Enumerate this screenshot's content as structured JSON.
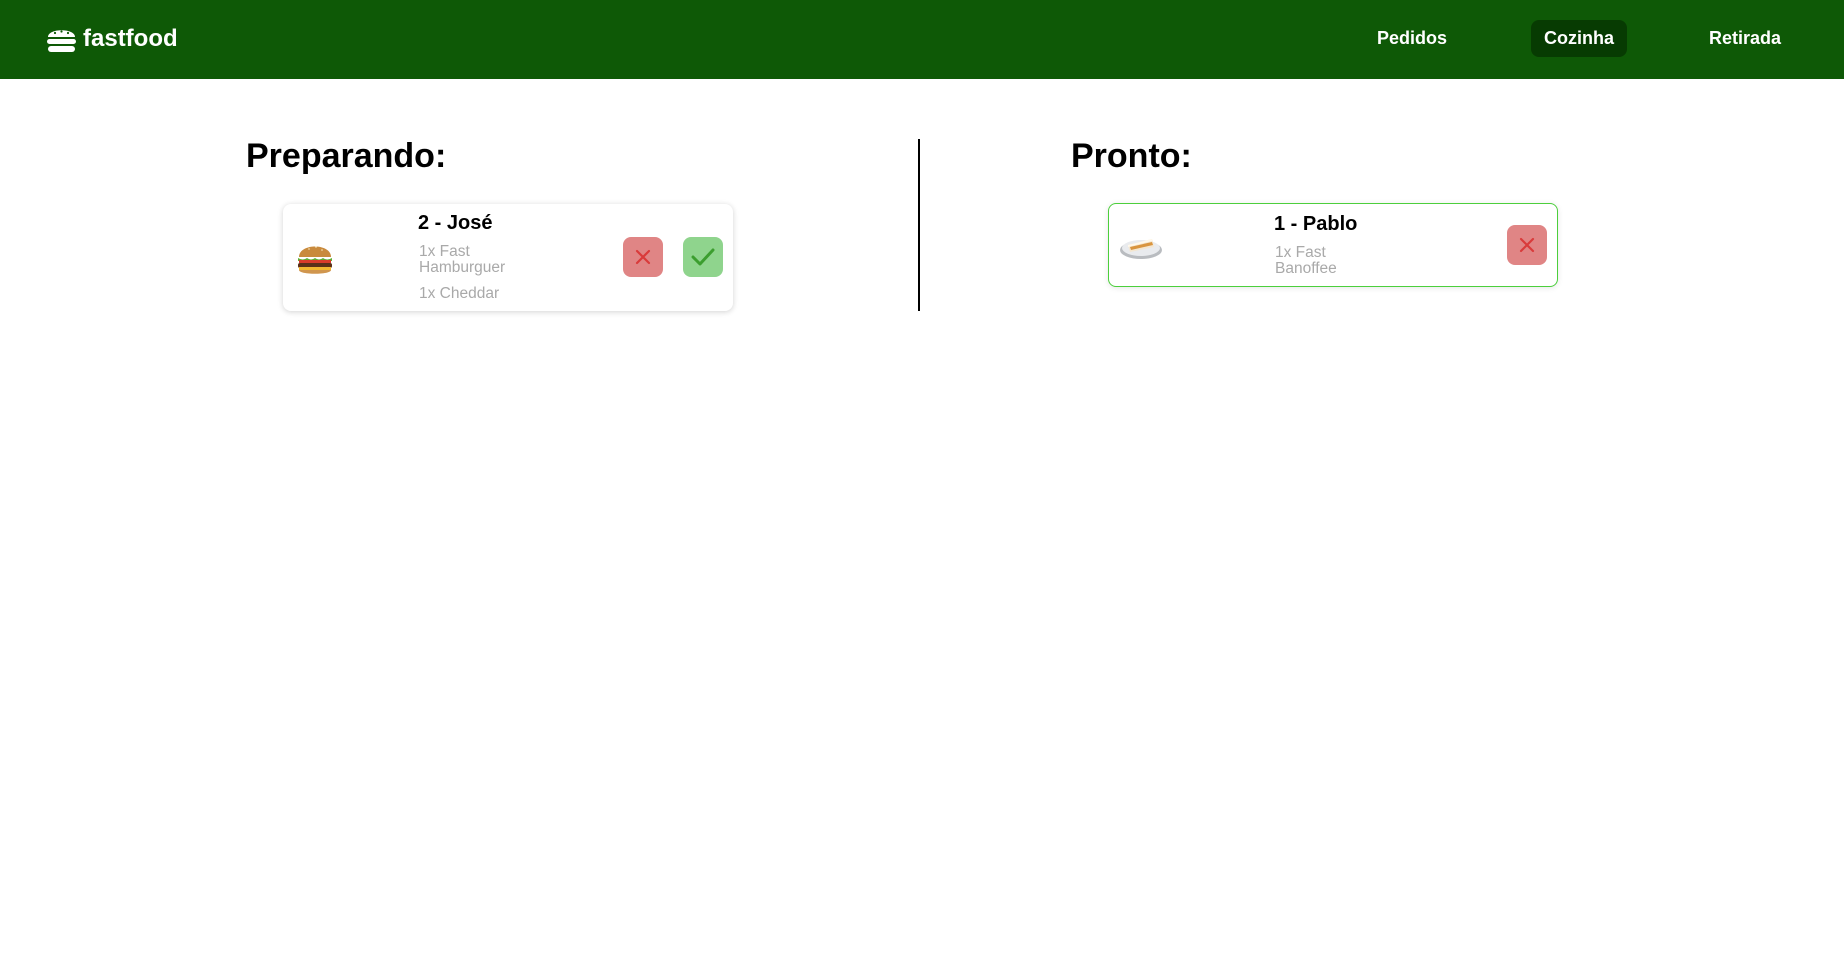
{
  "header": {
    "brand": "fastfood",
    "brand_icon": "burger-icon",
    "nav": [
      {
        "label": "Pedidos",
        "active": false
      },
      {
        "label": "Cozinha",
        "active": true
      },
      {
        "label": "Retirada",
        "active": false
      }
    ],
    "colors": {
      "header_bg": "#0e5906",
      "active_nav_bg": "#073b02"
    }
  },
  "columns": {
    "preparando": {
      "title": "Preparando:",
      "orders": [
        {
          "title": "2 - José",
          "image_icon": "hamburger-image",
          "items": [
            "1x Fast Hamburguer",
            "1x Cheddar"
          ],
          "actions": [
            "cancel-icon",
            "check-icon"
          ]
        }
      ]
    },
    "pronto": {
      "title": "Pronto:",
      "orders": [
        {
          "title": "1 - Pablo",
          "image_icon": "banoffee-image",
          "items": [
            "1x Fast Banoffee"
          ],
          "actions": [
            "cancel-icon"
          ]
        }
      ]
    }
  },
  "colors": {
    "cancel_button": "#e08585",
    "cancel_icon": "#d93b3b",
    "confirm_button": "#8fd48d",
    "confirm_icon": "#3c9e2f",
    "ready_border": "#4ccf3c",
    "item_text": "#a9a9a9"
  }
}
